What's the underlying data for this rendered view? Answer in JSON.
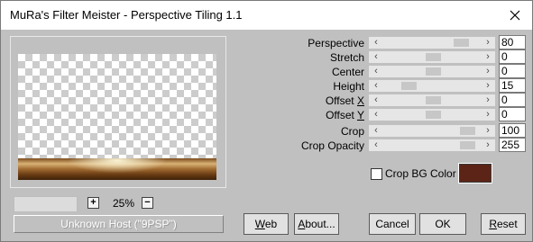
{
  "window": {
    "title": "MuRa's Filter Meister - Perspective Tiling 1.1"
  },
  "preview": {
    "zoom_in": "+",
    "zoom_value": "25%",
    "zoom_out": "−",
    "host_text": "Unknown Host (\"9PSP\")"
  },
  "params": [
    {
      "label": "Perspective",
      "value": "80",
      "position": 0.86
    },
    {
      "label": "Stretch",
      "value": "0",
      "position": 0.52
    },
    {
      "label": "Center",
      "value": "0",
      "position": 0.52
    },
    {
      "label": "Height",
      "value": "15",
      "position": 0.22
    },
    {
      "label_pre": "Offset ",
      "label_key": "X",
      "value": "0",
      "position": 0.52
    },
    {
      "label_pre": "Offset ",
      "label_key": "Y",
      "value": "0",
      "position": 0.52
    },
    {
      "label": "Crop",
      "value": "100",
      "position": 0.93
    },
    {
      "label": "Crop Opacity",
      "value": "255",
      "position": 0.93
    }
  ],
  "crop_bg": {
    "label": "Crop BG Color",
    "checked": false,
    "color": "#5c2416"
  },
  "buttons": {
    "web_key": "W",
    "web_rest": "eb",
    "about_key": "A",
    "about_rest": "bout...",
    "cancel": "Cancel",
    "ok": "OK",
    "reset_key": "R",
    "reset_rest": "eset"
  }
}
